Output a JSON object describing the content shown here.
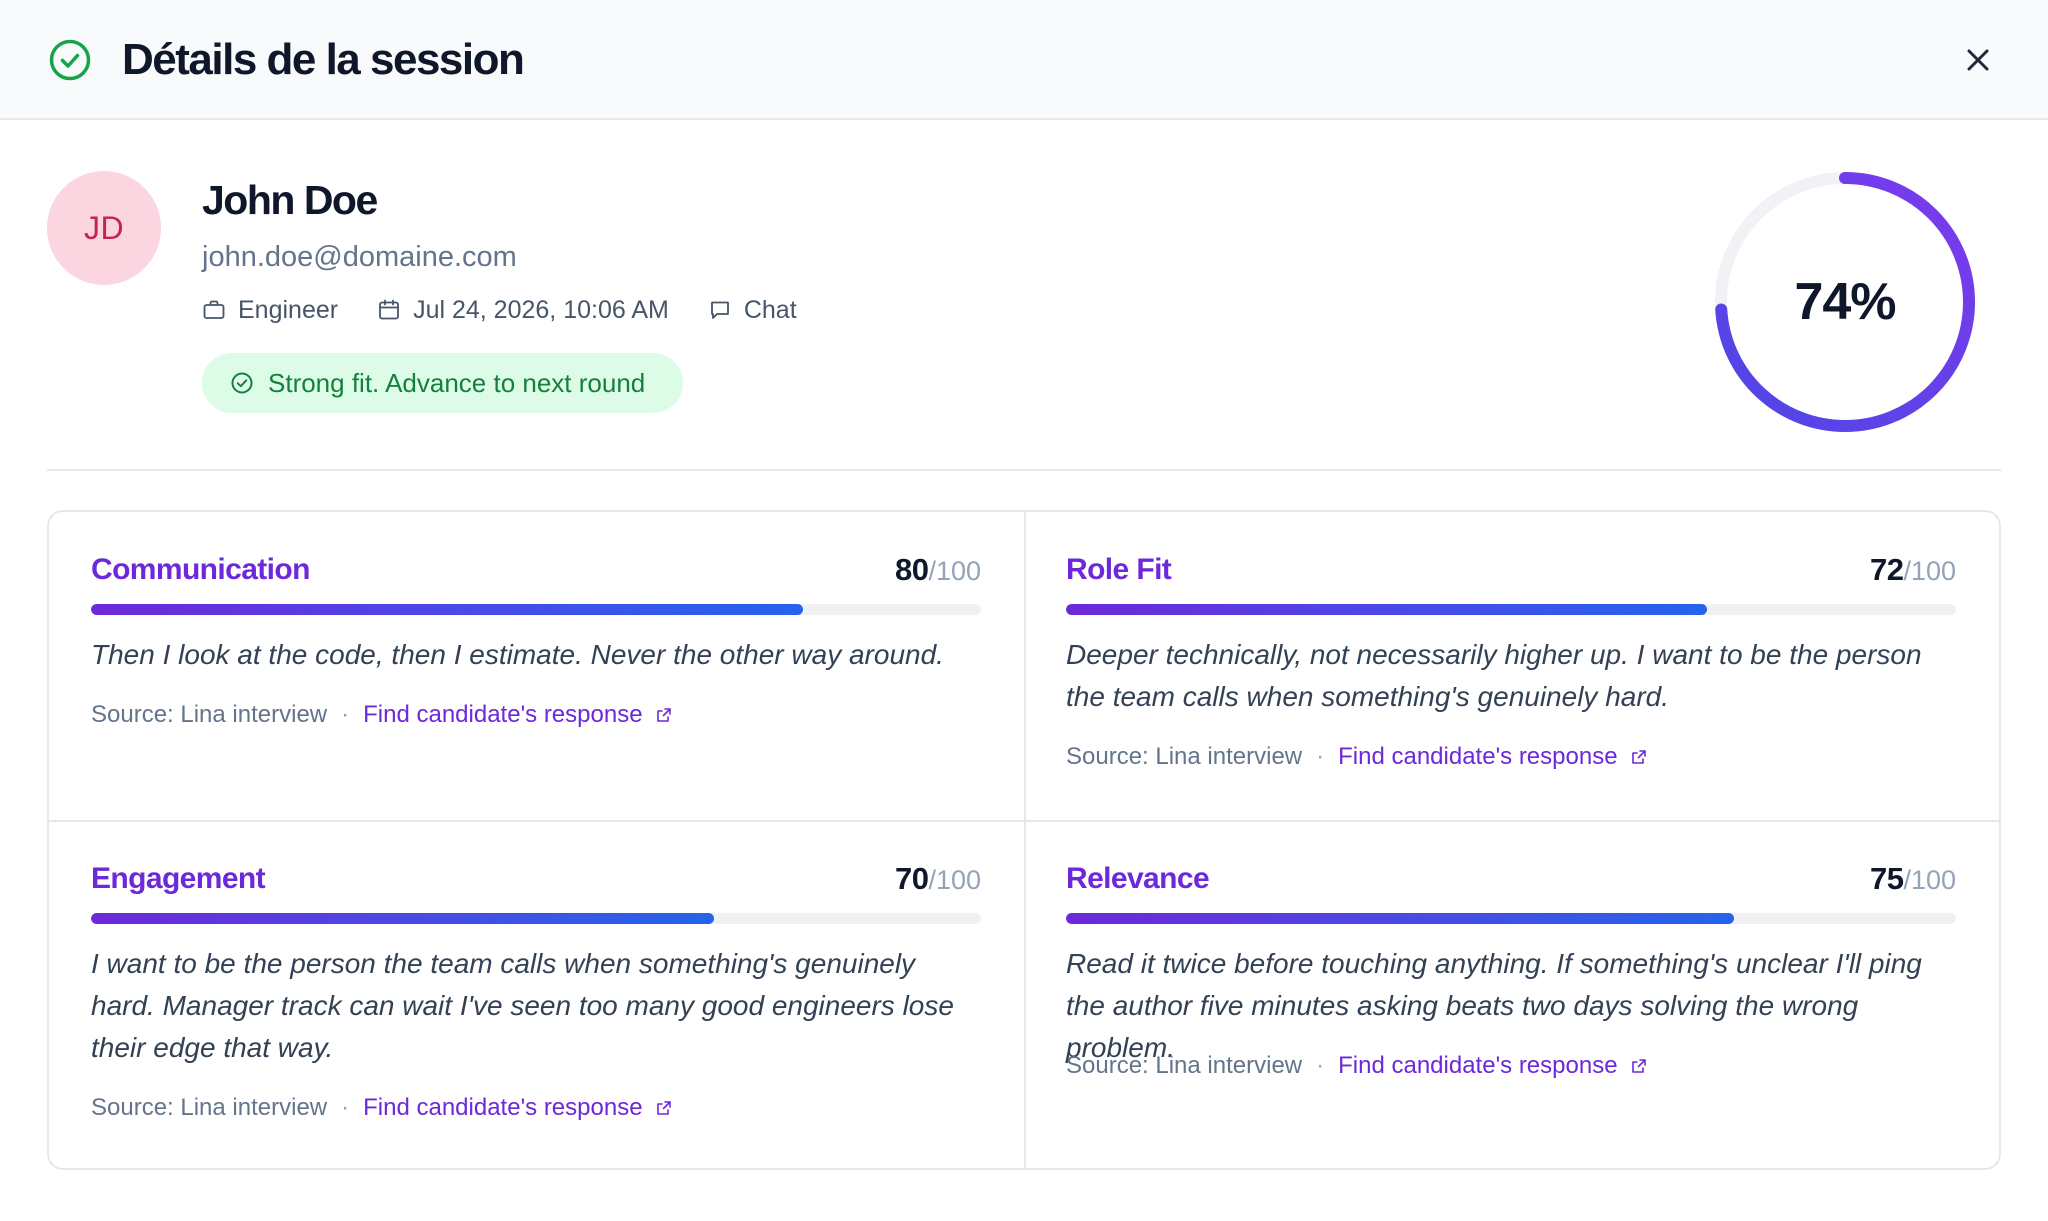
{
  "header": {
    "title": "Détails de la session",
    "icon": "check-circle-icon",
    "close_icon": "close-icon"
  },
  "candidate": {
    "initials": "JD",
    "name": "John Doe",
    "email": "john.doe@domaine.com",
    "role": "Engineer",
    "date": "Jul 24, 2026, 10:06 AM",
    "channel": "Chat",
    "verdict": "Strong fit. Advance to next round",
    "overall_score": "74%",
    "overall_score_fraction": 0.74
  },
  "colors": {
    "accent": "#6d28d9",
    "gauge_start": "#4f46e5",
    "gauge_end": "#7c3aed",
    "success": "#15803d",
    "success_bg": "#dcfce7",
    "avatar_bg": "#fbd5df",
    "avatar_text": "#c22456"
  },
  "criteria": [
    {
      "title": "Communication",
      "score": "80",
      "max": "/100",
      "fraction": 0.8,
      "quote": "Then I look at the code, then I estimate. Never the other way around.",
      "source": "Source: Lina interview",
      "link": "Find candidate's response"
    },
    {
      "title": "Role Fit",
      "score": "72",
      "max": "/100",
      "fraction": 0.72,
      "quote": "Deeper technically, not necessarily higher up. I want to be the person the team calls when something's genuinely hard.",
      "source": "Source: Lina interview",
      "link": "Find candidate's response"
    },
    {
      "title": "Engagement",
      "score": "70",
      "max": "/100",
      "fraction": 0.7,
      "quote": "I want to be the person the team calls when something's genuinely hard. Manager track can wait I've seen too many good engineers lose their edge that way.",
      "source": "Source: Lina interview",
      "link": "Find candidate's response"
    },
    {
      "title": "Relevance",
      "score": "75",
      "max": "/100",
      "fraction": 0.75,
      "quote": "Read it twice before touching anything. If something's unclear I'll ping the author five minutes asking beats two days solving the wrong problem.",
      "source": "Source: Lina interview",
      "link": "Find candidate's response"
    }
  ]
}
